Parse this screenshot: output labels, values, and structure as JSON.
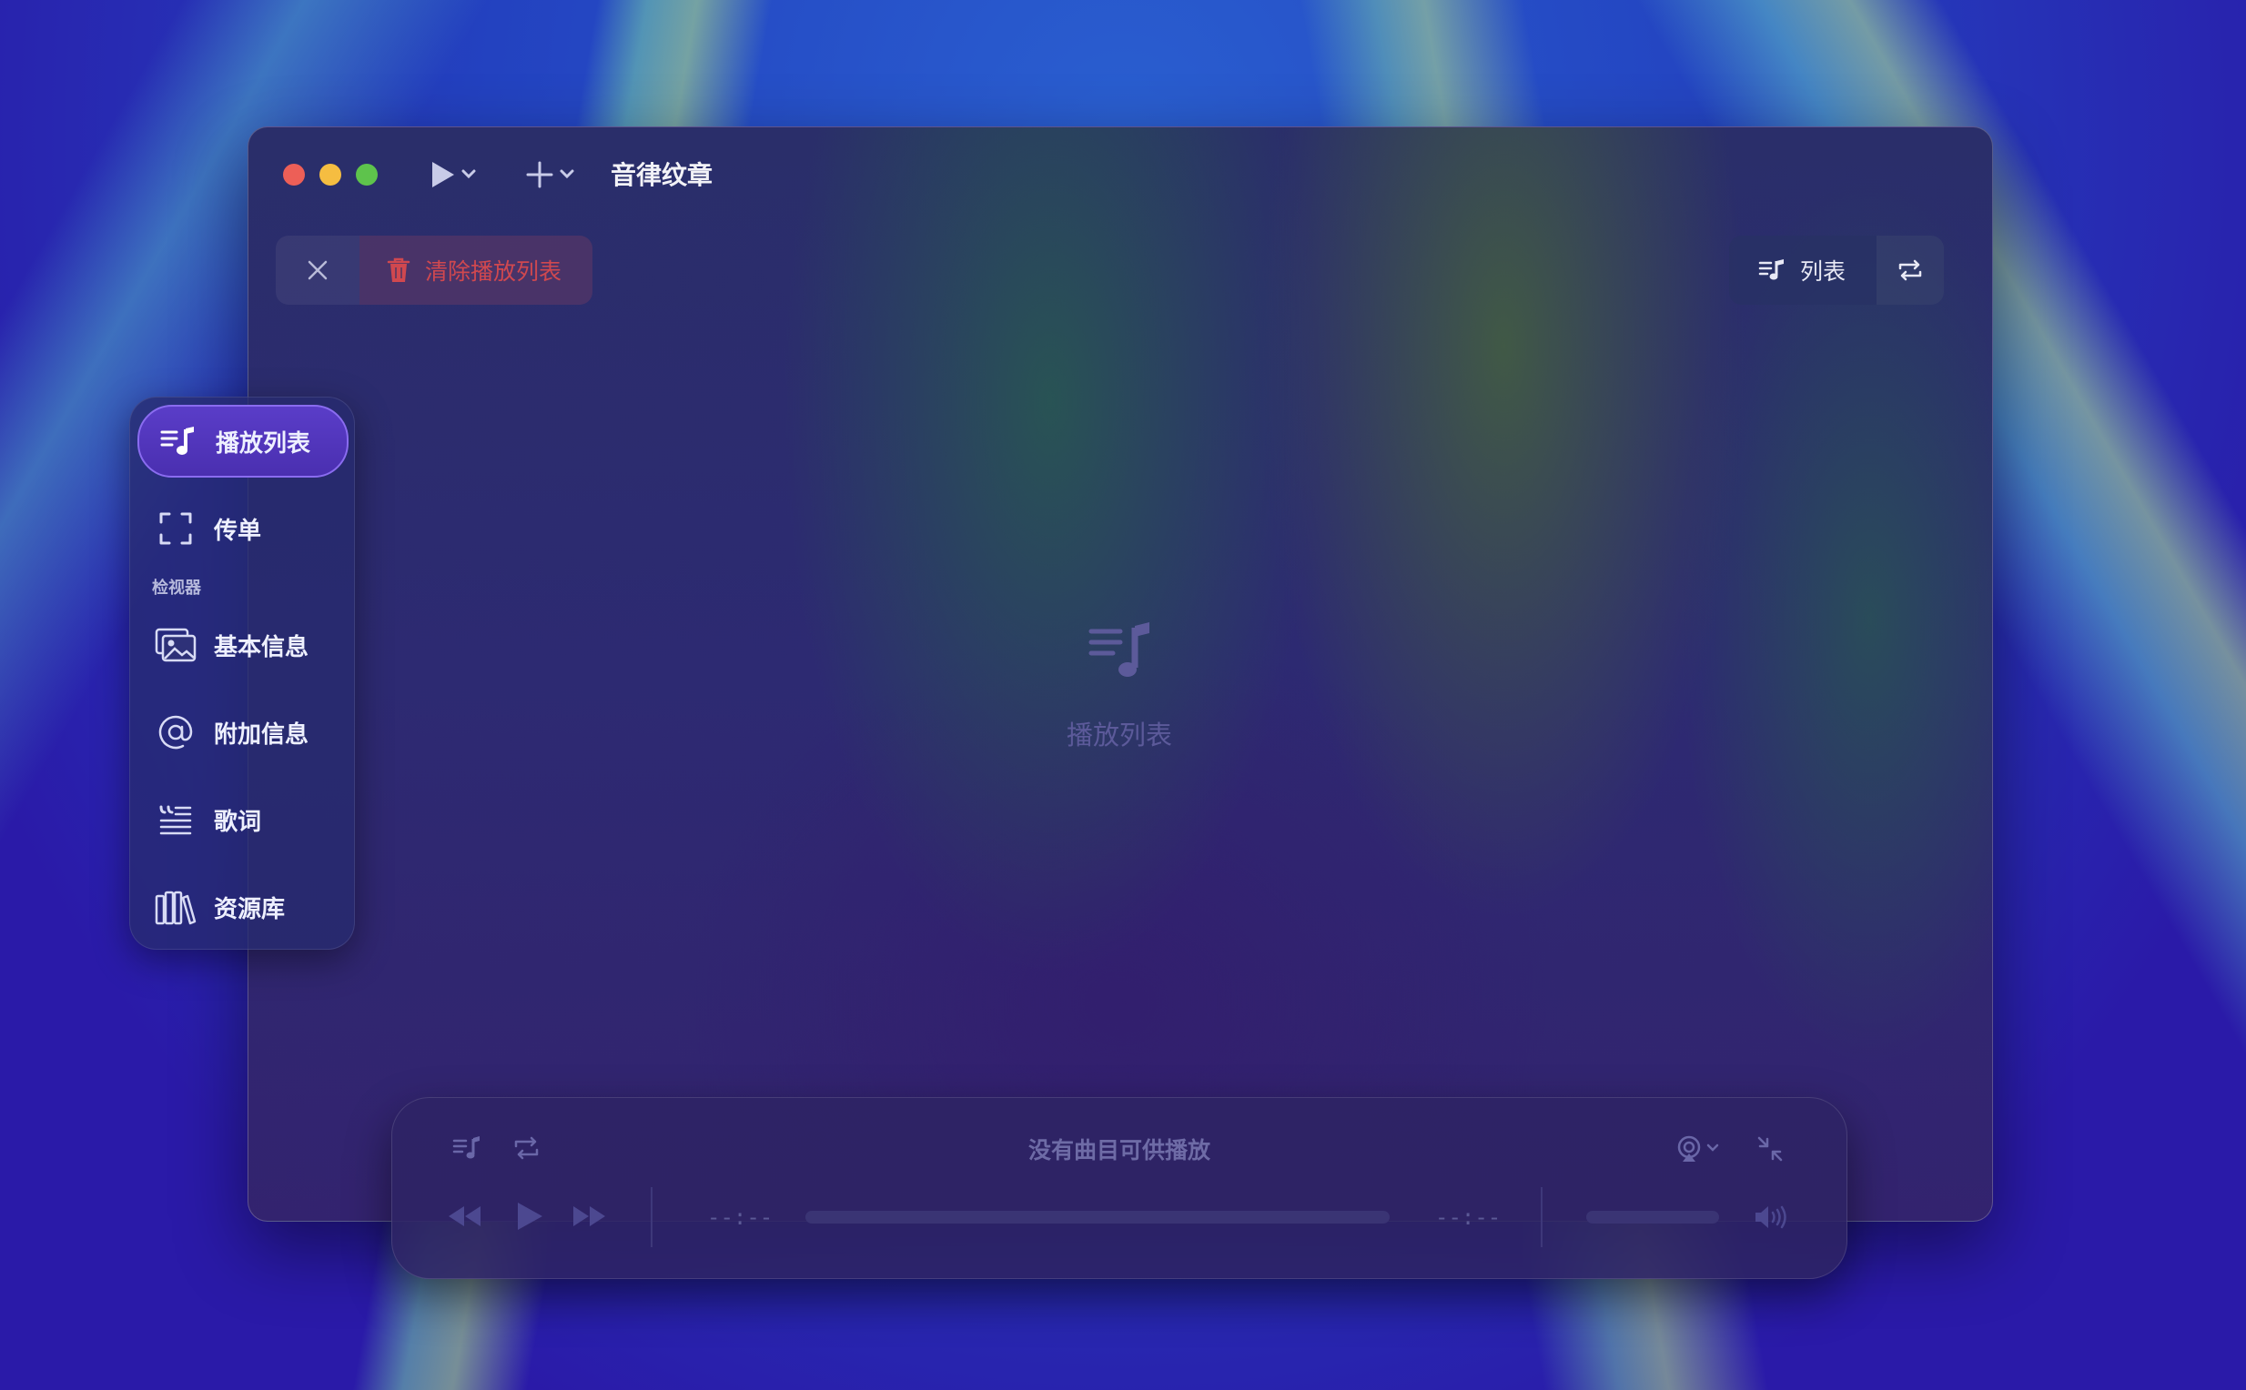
{
  "window": {
    "title": "音律纹章"
  },
  "toolbar": {
    "clear_playlist_label": "清除播放列表",
    "list_label": "列表"
  },
  "sidebar": {
    "items": [
      {
        "label": "播放列表",
        "icon": "playlist-icon",
        "active": true
      },
      {
        "label": "传单",
        "icon": "viewfinder-icon",
        "active": false
      }
    ],
    "section_label": "检视器",
    "inspector_items": [
      {
        "label": "基本信息",
        "icon": "photos-icon"
      },
      {
        "label": "附加信息",
        "icon": "at-icon"
      },
      {
        "label": "歌词",
        "icon": "lyrics-icon"
      },
      {
        "label": "资源库",
        "icon": "library-icon"
      }
    ]
  },
  "main": {
    "empty_label": "播放列表"
  },
  "player": {
    "status": "没有曲目可供播放",
    "elapsed": "--:--",
    "remaining": "--:--"
  },
  "colors": {
    "accent": "#5a3dc8",
    "danger": "#d0484f"
  }
}
